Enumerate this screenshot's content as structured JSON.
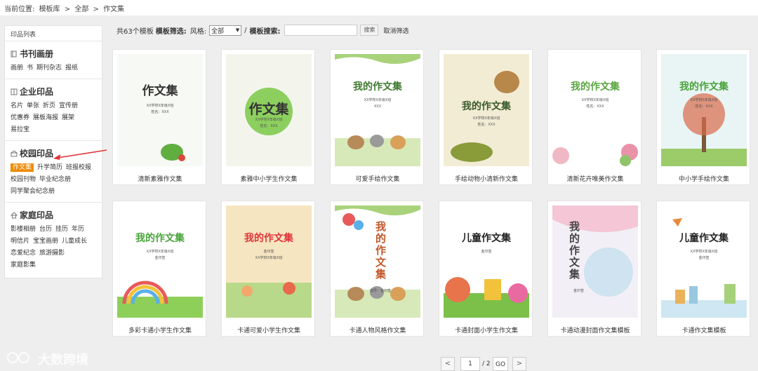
{
  "breadcrumb": {
    "prefix": "当前位置:",
    "items": [
      "模板库",
      "全部",
      "作文集"
    ],
    "sep": ">"
  },
  "sidebar": {
    "title": "印品列表",
    "groups": [
      {
        "title": "书刊画册",
        "icon": "book-icon",
        "links": [
          "画册",
          "书",
          "期刊杂志",
          "报纸"
        ]
      },
      {
        "title": "企业印品",
        "icon": "columns-icon",
        "links": [
          "名片",
          "单张",
          "折页",
          "宣传册",
          "优惠券",
          "展板海报",
          "展架",
          "易拉宝"
        ]
      },
      {
        "title": "校园印品",
        "icon": "school-icon",
        "links": [
          "作文集",
          "升学简历",
          "班报校报",
          "校园刊物",
          "毕业纪念册",
          "同学聚会纪念册"
        ],
        "active": "作文集"
      },
      {
        "title": "家庭印品",
        "icon": "home-icon",
        "links": [
          "影楼相册",
          "台历",
          "挂历",
          "年历",
          "明信片",
          "宝宝画册",
          "儿童成长",
          "恋爱纪念",
          "旅游摄影",
          "家庭影集"
        ]
      }
    ]
  },
  "filter": {
    "count": "共63个模板",
    "filter_label": "模板筛选:",
    "style_label": "风格:",
    "style_value": "全部",
    "slash": "/",
    "search_label": "模板搜索:",
    "search_value": "",
    "search_button": "搜索",
    "cancel": "取消筛选"
  },
  "templates": [
    {
      "caption": "清新素雅作文集",
      "cover_title": "作文集",
      "sub1": "XX学校X年级X班",
      "sub2": "姓名：XXX"
    },
    {
      "caption": "素雅中小学生作文集",
      "cover_title": "作文集",
      "sub1": "XX学校X年级X班",
      "sub2": "姓名：XXX"
    },
    {
      "caption": "可爱手绘作文集",
      "cover_title": "我的作文集",
      "sub1": "XX学校X年级X班",
      "sub2": "XXX"
    },
    {
      "caption": "手绘动物小清新作文集",
      "cover_title": "我的作文集",
      "sub1": "XX学校X年级X班",
      "sub2": "姓名：XXX"
    },
    {
      "caption": "清新花卉唯美作文集",
      "cover_title": "我的作文集",
      "sub1": "XX学校X年级X班",
      "sub2": "姓名：XXX"
    },
    {
      "caption": "中小学手绘作文集",
      "cover_title": "我的作文集",
      "sub1": "XX学校X年级X班",
      "sub2": "姓名：XXX"
    },
    {
      "caption": "多彩卡通小学生作文集",
      "cover_title": "我的作文集",
      "sub1": "XX学校X年级X班",
      "sub2": "金印签"
    },
    {
      "caption": "卡通可爱小学生作文集",
      "cover_title": "我的作文集",
      "sub1": "金印签",
      "sub2": "XX学校X年级X班"
    },
    {
      "caption": "卡通人物风格作文集",
      "cover_title": "我的作文集",
      "sub1": "指导：金印签",
      "sub2": ""
    },
    {
      "caption": "卡通封面小学生作文集",
      "cover_title": "儿童作文集",
      "sub1": "金印签",
      "sub2": ""
    },
    {
      "caption": "卡通动漫封面作文集模板",
      "cover_title": "我的作文集",
      "sub1": "金印签",
      "sub2": ""
    },
    {
      "caption": "卡通作文集模板",
      "cover_title": "儿童作文集",
      "sub1": "XX学校X年级X班",
      "sub2": "金印签"
    }
  ],
  "pager": {
    "prev": "<",
    "current": "1",
    "total": "/ 2",
    "go": "GO",
    "next": ">"
  },
  "watermark": {
    "text": "大数跨境"
  },
  "colors": {
    "active_tab": "#ee8b00",
    "arrow": "#e0343a",
    "green_title": "#5aa640"
  }
}
